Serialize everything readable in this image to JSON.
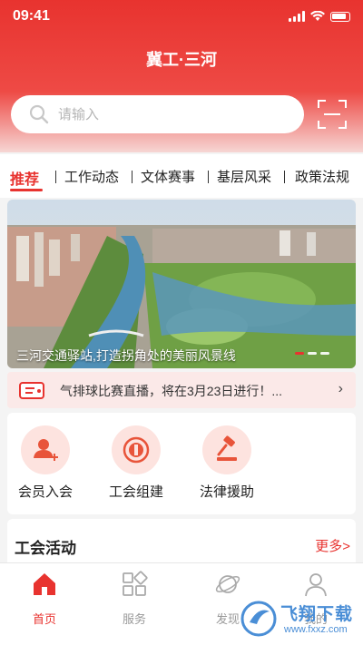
{
  "status_bar": {
    "time": "09:41"
  },
  "header": {
    "title": "冀工·三河"
  },
  "search": {
    "placeholder": "请输入"
  },
  "tabs": [
    {
      "label": "推荐"
    },
    {
      "label": "工作动态"
    },
    {
      "label": "文体赛事"
    },
    {
      "label": "基层风采"
    },
    {
      "label": "政策法规"
    }
  ],
  "banner": {
    "caption": "三河交通驿站,打造拐角处的美丽风景线"
  },
  "notice": {
    "text": "气排球比赛直播，将在3月23日进行！...",
    "arrow": "›"
  },
  "services": [
    {
      "label": "会员入会",
      "icon": "member-add-icon"
    },
    {
      "label": "工会组建",
      "icon": "union-build-icon"
    },
    {
      "label": "法律援助",
      "icon": "gavel-icon"
    }
  ],
  "activity": {
    "title": "工会活动",
    "more": "更多>"
  },
  "bottom_nav": [
    {
      "label": "首页",
      "icon": "home-icon"
    },
    {
      "label": "服务",
      "icon": "grid-icon"
    },
    {
      "label": "发现",
      "icon": "planet-icon"
    },
    {
      "label": "我的",
      "icon": "user-icon"
    }
  ],
  "watermark": {
    "text": "飞翔下载",
    "sub": "www.fxxz.com"
  },
  "colors": {
    "accent": "#e8332f",
    "soft": "#fde3df"
  }
}
